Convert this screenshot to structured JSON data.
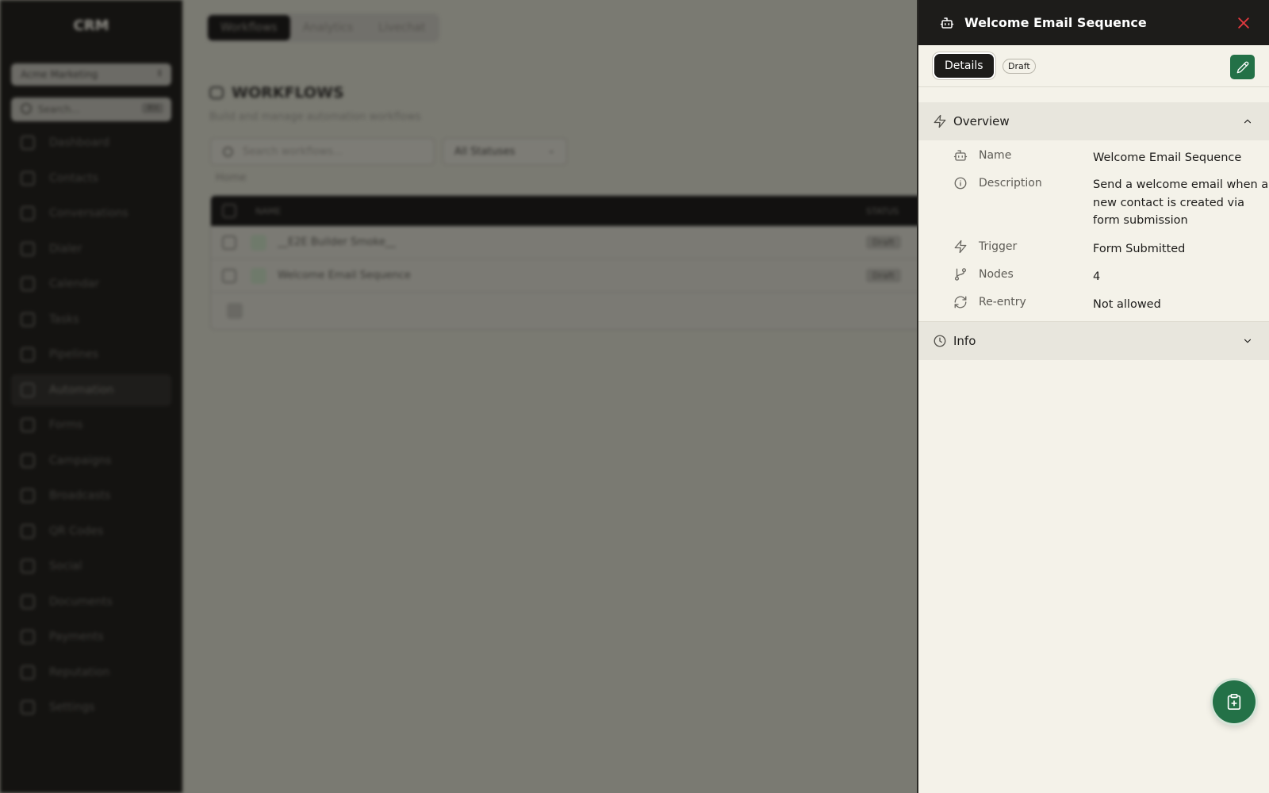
{
  "background": {
    "sidebar": {
      "logo": "CRM",
      "org_name": "Acme Marketing",
      "search_placeholder": "Search...",
      "search_shortcut": "⌘K",
      "items": [
        {
          "label": "Dashboard",
          "icon": "dashboard-icon"
        },
        {
          "label": "Contacts",
          "icon": "contacts-icon"
        },
        {
          "label": "Conversations",
          "icon": "conversations-icon"
        },
        {
          "label": "Dialer",
          "icon": "phone-icon"
        },
        {
          "label": "Calendar",
          "icon": "calendar-icon"
        },
        {
          "label": "Tasks",
          "icon": "folder-icon"
        },
        {
          "label": "Pipelines",
          "icon": "pipelines-icon"
        },
        {
          "label": "Automation",
          "icon": "robot-icon"
        },
        {
          "label": "Forms",
          "icon": "forms-icon"
        },
        {
          "label": "Campaigns",
          "icon": "mail-icon"
        },
        {
          "label": "Broadcasts",
          "icon": "broadcast-icon"
        },
        {
          "label": "QR Codes",
          "icon": "qr-code-icon"
        },
        {
          "label": "Social",
          "icon": "share-icon"
        },
        {
          "label": "Documents",
          "icon": "document-icon"
        },
        {
          "label": "Payments",
          "icon": "payments-icon"
        },
        {
          "label": "Reputation",
          "icon": "star-icon"
        },
        {
          "label": "Settings",
          "icon": "gear-icon"
        }
      ],
      "active_item": "Automation"
    },
    "tabs": [
      "Workflows",
      "Analytics",
      "Livechat"
    ],
    "active_tab": "Workflows",
    "page_title": "WORKFLOWS",
    "page_subtitle": "Build and manage automation workflows",
    "search_placeholder": "Search workflows...",
    "status_filter": "All Statuses",
    "breadcrumb": "Home",
    "table": {
      "columns": [
        "NAME",
        "STATUS"
      ],
      "rows": [
        {
          "name": "__E2E Builder Smoke__",
          "status": "Draft"
        },
        {
          "name": "Welcome Email Sequence",
          "status": "Draft"
        }
      ]
    }
  },
  "drawer": {
    "title": "Welcome Email Sequence",
    "active_tab": "Details",
    "status_badge": "Draft",
    "overview": {
      "heading": "Overview",
      "fields": {
        "name": {
          "label": "Name",
          "value": "Welcome Email Sequence"
        },
        "description": {
          "label": "Description",
          "value": "Send a welcome email when a new contact is created via form submission"
        },
        "trigger": {
          "label": "Trigger",
          "value": "Form Submitted"
        },
        "nodes": {
          "label": "Nodes",
          "value": "4"
        },
        "reentry": {
          "label": "Re-entry",
          "value": "Not allowed"
        }
      }
    },
    "info": {
      "heading": "Info"
    }
  },
  "colors": {
    "accent_green": "#237147",
    "close_red": "#e0393e",
    "header_dark": "#1d1c1a",
    "drawer_bg": "#f4f2e9"
  }
}
